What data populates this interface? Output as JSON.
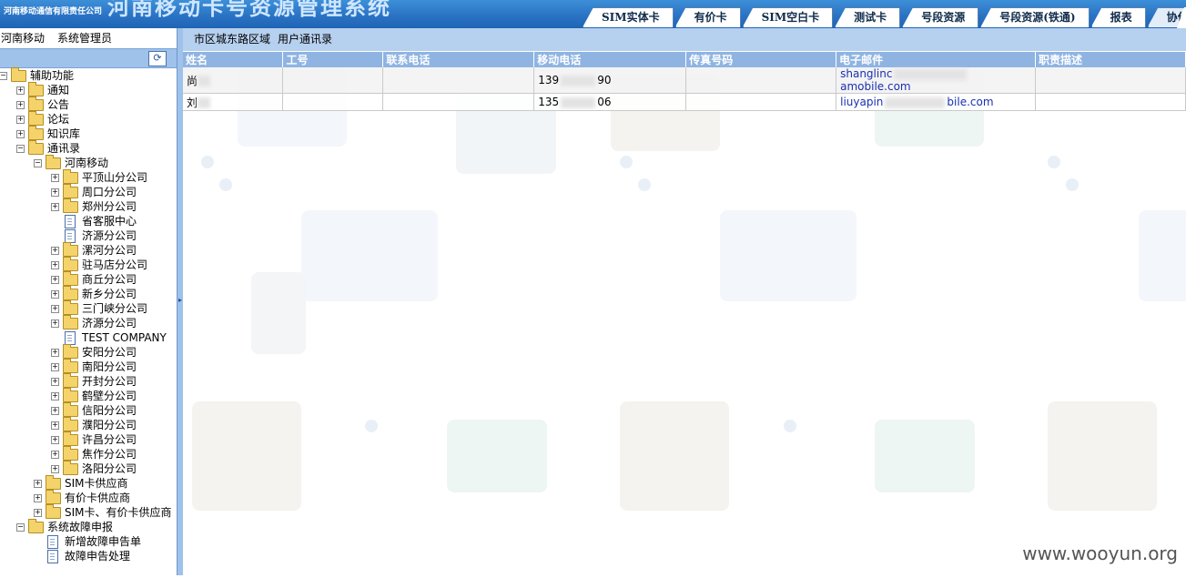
{
  "header": {
    "logo_text": "河南移动通信有限责任公司",
    "system_title": "河南移动卡号资源管理系统",
    "tabs": [
      "SIM实体卡",
      "有价卡",
      "SIM空白卡",
      "测试卡",
      "号段资源",
      "号段资源(铁通)",
      "报表",
      "协作"
    ],
    "active_tab": "协作"
  },
  "left": {
    "org": "河南移动",
    "role": "系统管理员",
    "refresh_icon": "refresh-icon",
    "tree": [
      {
        "label": "辅助功能",
        "kind": "folder",
        "state": "open"
      },
      {
        "label": "通知",
        "kind": "folder",
        "state": "closed"
      },
      {
        "label": "公告",
        "kind": "folder",
        "state": "closed"
      },
      {
        "label": "论坛",
        "kind": "folder",
        "state": "closed"
      },
      {
        "label": "知识库",
        "kind": "folder",
        "state": "closed"
      },
      {
        "label": "通讯录",
        "kind": "folder",
        "state": "open"
      },
      {
        "label": "河南移动",
        "kind": "folder",
        "state": "open"
      },
      {
        "label": "平顶山分公司",
        "kind": "folder",
        "state": "closed"
      },
      {
        "label": "周口分公司",
        "kind": "folder",
        "state": "closed"
      },
      {
        "label": "郑州分公司",
        "kind": "folder",
        "state": "closed"
      },
      {
        "label": "省客服中心",
        "kind": "doc"
      },
      {
        "label": "济源分公司",
        "kind": "doc"
      },
      {
        "label": "漯河分公司",
        "kind": "folder",
        "state": "closed"
      },
      {
        "label": "驻马店分公司",
        "kind": "folder",
        "state": "closed"
      },
      {
        "label": "商丘分公司",
        "kind": "folder",
        "state": "closed"
      },
      {
        "label": "新乡分公司",
        "kind": "folder",
        "state": "closed"
      },
      {
        "label": "三门峡分公司",
        "kind": "folder",
        "state": "closed"
      },
      {
        "label": "济源分公司",
        "kind": "folder",
        "state": "closed"
      },
      {
        "label": "TEST COMPANY",
        "kind": "doc"
      },
      {
        "label": "安阳分公司",
        "kind": "folder",
        "state": "closed"
      },
      {
        "label": "南阳分公司",
        "kind": "folder",
        "state": "closed"
      },
      {
        "label": "开封分公司",
        "kind": "folder",
        "state": "closed"
      },
      {
        "label": "鹤壁分公司",
        "kind": "folder",
        "state": "closed"
      },
      {
        "label": "信阳分公司",
        "kind": "folder",
        "state": "closed"
      },
      {
        "label": "濮阳分公司",
        "kind": "folder",
        "state": "closed"
      },
      {
        "label": "许昌分公司",
        "kind": "folder",
        "state": "closed"
      },
      {
        "label": "焦作分公司",
        "kind": "folder",
        "state": "closed"
      },
      {
        "label": "洛阳分公司",
        "kind": "folder",
        "state": "closed"
      },
      {
        "label": "SIM卡供应商",
        "kind": "folder",
        "state": "closed"
      },
      {
        "label": "有价卡供应商",
        "kind": "folder",
        "state": "closed"
      },
      {
        "label": "SIM卡、有价卡供应商",
        "kind": "folder",
        "state": "closed"
      },
      {
        "label": "系统故障申报",
        "kind": "folder",
        "state": "open"
      },
      {
        "label": "新增故障申告单",
        "kind": "doc"
      },
      {
        "label": "故障申告处理",
        "kind": "doc"
      }
    ]
  },
  "main": {
    "crumb_area": "市区城东路区域",
    "crumb_page": "用户通讯录",
    "columns": [
      "姓名",
      "工号",
      "联系电话",
      "移动电话",
      "传真号码",
      "电子邮件",
      "职责描述"
    ],
    "rows": [
      {
        "name": "尚",
        "emp_id": "",
        "tel": "",
        "mobile_pre": "139",
        "mobile_post": "90",
        "fax": "",
        "email_pre": "shanglinc",
        "email_post": "amobile.com",
        "duty": ""
      },
      {
        "name": "刘",
        "emp_id": "",
        "tel": "",
        "mobile_pre": "135",
        "mobile_post": "06",
        "fax": "",
        "email_pre": "liuyapin",
        "email_post": "bile.com",
        "duty": ""
      }
    ]
  },
  "footer": {
    "watermark": "www.wooyun.org"
  }
}
